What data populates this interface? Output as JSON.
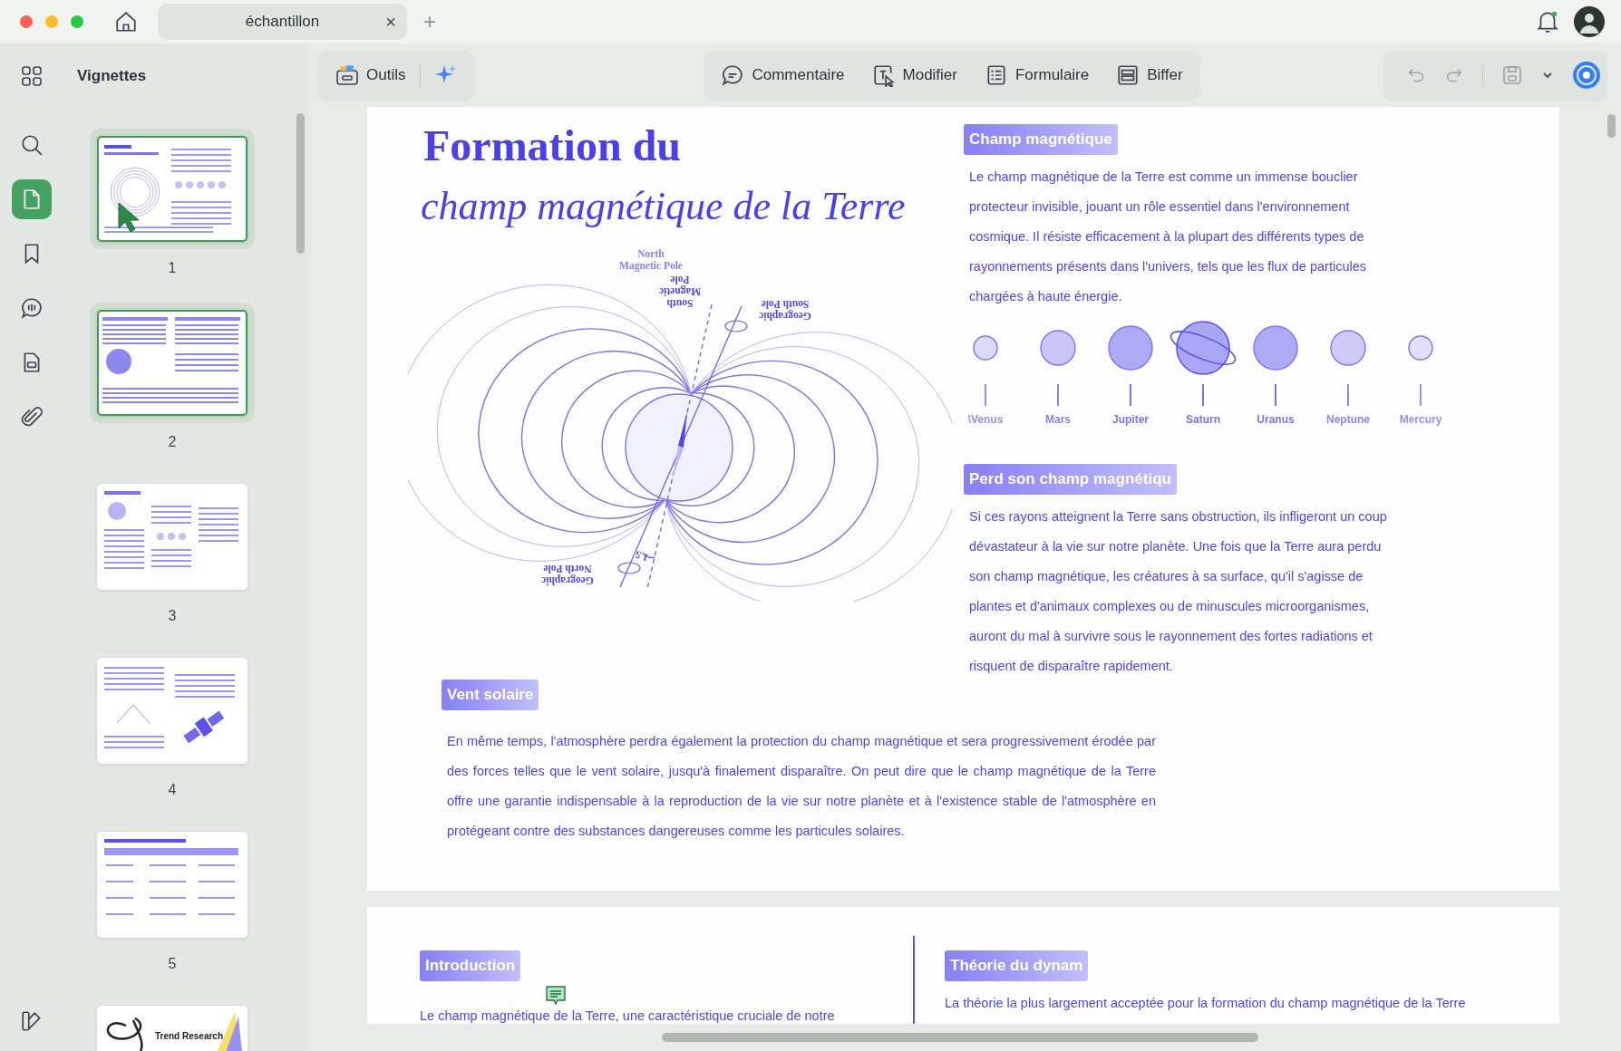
{
  "window": {
    "tab": {
      "title": "échantillon",
      "close": "×"
    },
    "new_tab": "+"
  },
  "sidebar": {
    "title": "Vignettes",
    "rail": [
      {
        "kind": "search",
        "selected": false
      },
      {
        "kind": "pages",
        "selected": true
      },
      {
        "kind": "bookmark",
        "selected": false
      },
      {
        "kind": "comment",
        "selected": false
      },
      {
        "kind": "form",
        "selected": false
      },
      {
        "kind": "attachment",
        "selected": false
      }
    ],
    "thumbnails": [
      {
        "kind": "cover",
        "page": "1",
        "selected": true
      },
      {
        "kind": "text",
        "page": "2",
        "selected": true
      },
      {
        "kind": "columns",
        "page": "3",
        "selected": false
      },
      {
        "kind": "satellite",
        "page": "4",
        "selected": false
      },
      {
        "kind": "table",
        "page": "5",
        "selected": false
      },
      {
        "kind": "brand",
        "caption": "Trend Research",
        "selected": false
      }
    ]
  },
  "toolbar": {
    "left": [
      {
        "kind": "tools",
        "label": "Outils"
      },
      {
        "kind": "ai"
      }
    ],
    "modes": [
      {
        "kind": "comment",
        "label": "Commentaire"
      },
      {
        "kind": "edit",
        "label": "Modifier"
      },
      {
        "kind": "form",
        "label": "Formulaire"
      },
      {
        "kind": "redact",
        "label": "Biffer"
      }
    ]
  },
  "page1": {
    "title": "Formation du",
    "subtitle": "champ magnétique de la Terre",
    "diagram_labels": [
      {
        "kind": "upright",
        "lines": [
          "North",
          "Magnetic Pole"
        ]
      },
      {
        "kind": "flipped",
        "lines": [
          "South",
          "Magnetic",
          "Pole"
        ]
      },
      {
        "kind": "flipped",
        "lines": [
          "Geographic",
          "South Pole"
        ]
      },
      {
        "kind": "flipped",
        "lines": [
          "Geographic",
          "North Pole"
        ]
      },
      {
        "kind": "angle",
        "lines": [
          "1.5"
        ]
      }
    ],
    "sections": [
      {
        "heading": "Champ magnétique",
        "text": "Le champ magnétique de la Terre est comme un immense bouclier protecteur invisible, jouant un rôle essentiel dans l'environnement cosmique. Il résiste efficacement à la plupart des différents types de rayonnements présents dans l'univers, tels que les flux de particules chargées à haute énergie."
      },
      {
        "heading": "Perd son champ magnétiqu",
        "text": "Si ces rayons atteignent la Terre sans obstruction, ils infligeront un coup dévastateur à la vie sur notre planète. Une fois que la Terre aura perdu son champ magnétique, les créatures à sa surface, qu'il s'agisse de plantes et d'animaux complexes ou de minuscules microorganismes, auront du mal à survivre sous le rayonnement des fortes radiations et risquent de disparaître rapidement."
      }
    ],
    "planets": [
      {
        "name": "\\Venus",
        "kind": "plain",
        "color": "#dcdaf9"
      },
      {
        "name": "Mars",
        "kind": "plain",
        "color": "#c9c6f7"
      },
      {
        "name": "Jupiter",
        "kind": "plain",
        "color": "#aeaaf5"
      },
      {
        "name": "Saturn",
        "kind": "ringed",
        "color": "#aaa6f6"
      },
      {
        "name": "Uranus",
        "kind": "plain",
        "color": "#aeaaf5"
      },
      {
        "name": "Neptune",
        "kind": "plain",
        "color": "#cdcaf8"
      },
      {
        "name": "Mercury",
        "kind": "plain",
        "color": "#e2e0fa"
      }
    ],
    "vent": {
      "heading": "Vent solaire",
      "text": "En même temps, l'atmosphère perdra également la protection du champ magnétique et sera progressivement érodée par des forces telles que le vent solaire, jusqu'à finalement disparaître. On peut dire que le champ magnétique de la Terre offre une garantie indispensable à la reproduction de la vie sur notre planète et à l'existence stable de l'atmosphère en protégeant contre des substances dangereuses comme les particules solaires."
    }
  },
  "page2": {
    "left": {
      "heading": "Introduction",
      "text": "Le champ magnétique de la Terre, une caractéristique cruciale de notre"
    },
    "right": {
      "heading": "Théorie du dynam",
      "text": "La théorie la plus largement acceptée pour la formation du champ magnétique de la Terre"
    }
  }
}
